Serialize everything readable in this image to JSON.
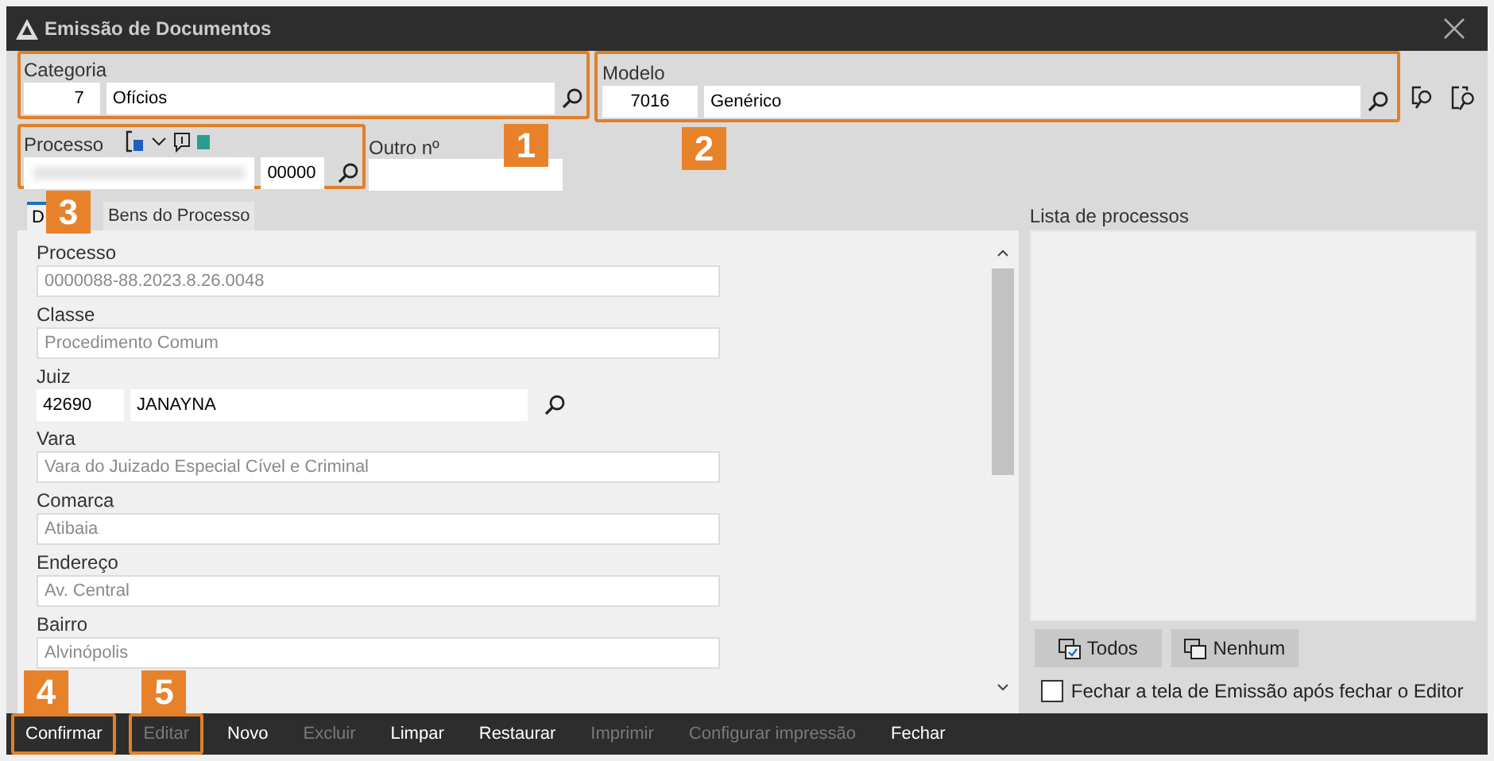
{
  "window": {
    "title": "Emissão de Documentos"
  },
  "categoria": {
    "label": "Categoria",
    "code": "7",
    "value": "Ofícios",
    "callout": "1"
  },
  "modelo": {
    "label": "Modelo",
    "code": "7016",
    "value": "Genérico",
    "callout": "2"
  },
  "processo": {
    "label": "Processo",
    "suffix": "00000",
    "callout": "3"
  },
  "outro": {
    "label": "Outro nº"
  },
  "tabs": [
    {
      "label": "D",
      "selected": true
    },
    {
      "label": "Bens do Processo",
      "selected": false
    }
  ],
  "fields": [
    {
      "kind": "text",
      "label": "Processo",
      "value": "0000088-88.2023.8.26.0048",
      "disabled": true
    },
    {
      "kind": "text",
      "label": "Classe",
      "value": "Procedimento Comum",
      "disabled": true
    },
    {
      "kind": "lookup",
      "label": "Juiz",
      "code": "42690",
      "value": "JANAYNA",
      "disabled": false
    },
    {
      "kind": "text",
      "label": "Vara",
      "value": "Vara do Juizado Especial Cível e Criminal",
      "disabled": true
    },
    {
      "kind": "text",
      "label": "Comarca",
      "value": "Atibaia",
      "disabled": true
    },
    {
      "kind": "text",
      "label": "Endereço",
      "value": "Av. Central",
      "disabled": true
    },
    {
      "kind": "text",
      "label": "Bairro",
      "value": "Alvinópolis",
      "disabled": true
    }
  ],
  "lista": {
    "label": "Lista de processos",
    "buttons": [
      {
        "kind": "all",
        "label": "Todos"
      },
      {
        "kind": "none",
        "label": "Nenhum"
      }
    ]
  },
  "close_option": {
    "label": "Fechar a tela de Emissão após fechar o Editor",
    "checked": false
  },
  "toolbar": [
    {
      "label": "Confirmar",
      "disabled": false,
      "callout": "4"
    },
    {
      "label": "Editar",
      "disabled": true,
      "callout": "5"
    },
    {
      "label": "Novo",
      "disabled": false
    },
    {
      "label": "Excluir",
      "disabled": true
    },
    {
      "label": "Limpar",
      "disabled": false
    },
    {
      "label": "Restaurar",
      "disabled": false
    },
    {
      "label": "Imprimir",
      "disabled": true
    },
    {
      "label": "Configurar impressão",
      "disabled": true
    },
    {
      "label": "Fechar",
      "disabled": false
    }
  ]
}
